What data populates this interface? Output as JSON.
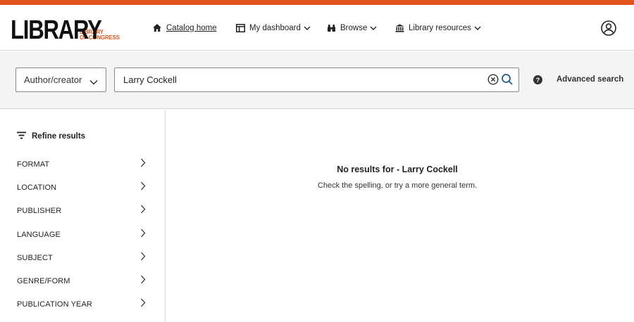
{
  "brand": {
    "logo_main": "LIBRARY",
    "logo_sub_line1": "LIBRARY",
    "logo_sub_line2": "OF CONGRESS",
    "accent_color": "#e0541e"
  },
  "nav": {
    "catalog_home": "Catalog home",
    "my_dashboard": "My dashboard",
    "browse": "Browse",
    "library_resources": "Library resources"
  },
  "search": {
    "field_type": "Author/creator",
    "query": "Larry Cockell",
    "help": "?",
    "advanced_search": "Advanced search"
  },
  "sidebar": {
    "refine_title": "Refine results",
    "facets": [
      {
        "label": "FORMAT"
      },
      {
        "label": "LOCATION"
      },
      {
        "label": "PUBLISHER"
      },
      {
        "label": "LANGUAGE"
      },
      {
        "label": "SUBJECT"
      },
      {
        "label": "GENRE/FORM"
      },
      {
        "label": "PUBLICATION YEAR"
      }
    ]
  },
  "results": {
    "no_results": "No results for - Larry Cockell",
    "hint": "Check the spelling, or try a more general term."
  },
  "icons": [
    "home-icon",
    "dashboard-icon",
    "binoculars-icon",
    "institution-icon",
    "chevron-down-icon",
    "user-account-icon",
    "clear-icon",
    "search-icon",
    "help-icon",
    "filter-icon",
    "chevron-right-icon"
  ]
}
